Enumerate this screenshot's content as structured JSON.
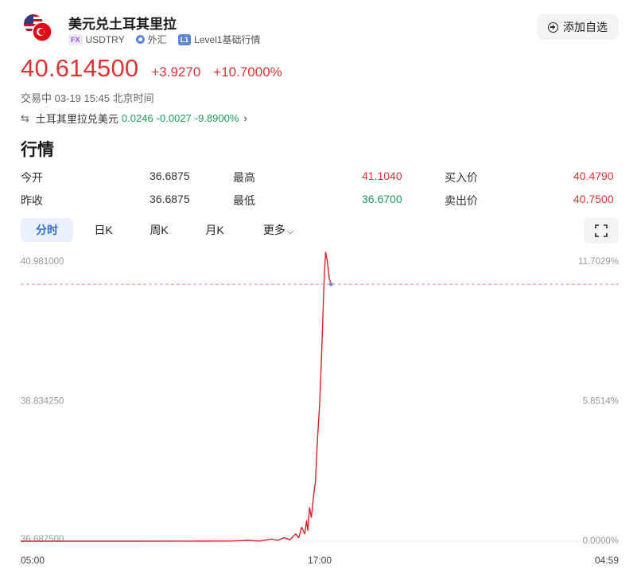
{
  "header": {
    "title": "美元兑土耳其里拉",
    "fx_tag": "FX",
    "symbol": "USDTRY",
    "market": "外汇",
    "level_tag": "L1",
    "level_text": "Level1基础行情",
    "add_button": "添加自选"
  },
  "quote": {
    "price": "40.614500",
    "change": "+3.9270",
    "change_pct": "+10.7000%",
    "status": "交易中 03-19 15:45 北京时间"
  },
  "reverse_pair": {
    "name": "土耳其里拉兑美元",
    "price": "0.0246",
    "change": "-0.0027",
    "change_pct": "-9.8900%"
  },
  "section_title": "行情",
  "stats": {
    "open_label": "今开",
    "open_value": "36.6875",
    "high_label": "最高",
    "high_value": "41.1040",
    "bid_label": "买入价",
    "bid_value": "40.4790",
    "prev_close_label": "昨收",
    "prev_close_value": "36.6875",
    "low_label": "最低",
    "low_value": "36.6700",
    "ask_label": "卖出价",
    "ask_value": "40.7500"
  },
  "tabs": [
    "分时",
    "日K",
    "周K",
    "月K",
    "更多"
  ],
  "active_tab": "分时",
  "chart_data": {
    "type": "line",
    "y_left_ticks": [
      "40.981000",
      "38.834250",
      "36.687500"
    ],
    "y_right_ticks": [
      "11.7029%",
      "5.8514%",
      "0.0000%"
    ],
    "x_ticks": [
      "05:00",
      "17:00",
      "04:59"
    ],
    "ylim": [
      36.6875,
      40.981
    ],
    "current_price": 40.6145,
    "series": [
      {
        "color": "#d9232a",
        "points": [
          [
            0,
            36.6875
          ],
          [
            0.1,
            36.6875
          ],
          [
            0.2,
            36.688
          ],
          [
            0.28,
            36.689
          ],
          [
            0.35,
            36.69
          ],
          [
            0.38,
            36.7
          ],
          [
            0.4,
            36.69
          ],
          [
            0.42,
            36.72
          ],
          [
            0.43,
            36.7
          ],
          [
            0.44,
            36.74
          ],
          [
            0.45,
            36.71
          ],
          [
            0.46,
            36.8
          ],
          [
            0.465,
            36.74
          ],
          [
            0.47,
            36.9
          ],
          [
            0.475,
            36.8
          ],
          [
            0.478,
            37.0
          ],
          [
            0.48,
            36.85
          ],
          [
            0.483,
            37.2
          ],
          [
            0.486,
            37.05
          ],
          [
            0.49,
            37.4
          ],
          [
            0.493,
            37.6
          ],
          [
            0.496,
            38.2
          ],
          [
            0.5,
            38.8
          ],
          [
            0.503,
            39.5
          ],
          [
            0.506,
            40.3
          ],
          [
            0.508,
            40.8
          ],
          [
            0.51,
            41.104
          ],
          [
            0.513,
            40.95
          ],
          [
            0.516,
            40.7
          ],
          [
            0.519,
            40.6145
          ]
        ]
      }
    ]
  }
}
